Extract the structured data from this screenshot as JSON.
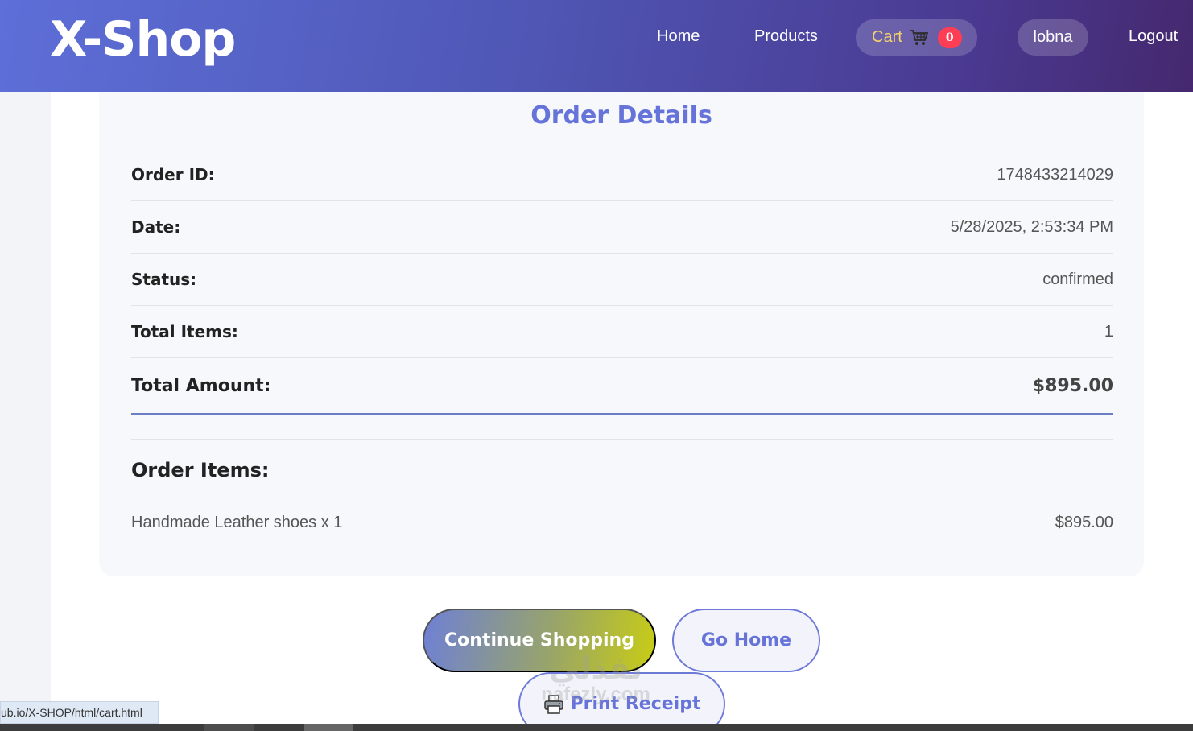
{
  "header": {
    "logo": "X-Shop",
    "nav": {
      "home": "Home",
      "products": "Products",
      "cart": "Cart",
      "cart_count": "0",
      "user": "lobna",
      "logout": "Logout"
    }
  },
  "order": {
    "title": "Order Details",
    "rows": [
      {
        "label": "Order ID:",
        "value": "1748433214029"
      },
      {
        "label": "Date:",
        "value": "5/28/2025, 2:53:34 PM"
      },
      {
        "label": "Status:",
        "value": "confirmed"
      },
      {
        "label": "Total Items:",
        "value": "1"
      }
    ],
    "total": {
      "label": "Total Amount:",
      "value": "$895.00"
    },
    "items_heading": "Order Items:",
    "items": [
      {
        "name": "Handmade Leather shoes x 1",
        "price": "$895.00"
      }
    ]
  },
  "actions": {
    "continue": "Continue Shopping",
    "home": "Go Home",
    "print": "Print Receipt"
  },
  "watermark": {
    "arabic": "نفذلي",
    "latin": "nafezly.com"
  },
  "status_bar": {
    "url": "ub.io/X-SHOP/html/cart.html"
  },
  "colors": {
    "accent": "#6673d8",
    "cart_badge": "#ff3e55",
    "cart_label": "#f6d26a"
  },
  "icons": {
    "cart": "shopping-cart-icon",
    "print": "printer-icon"
  }
}
